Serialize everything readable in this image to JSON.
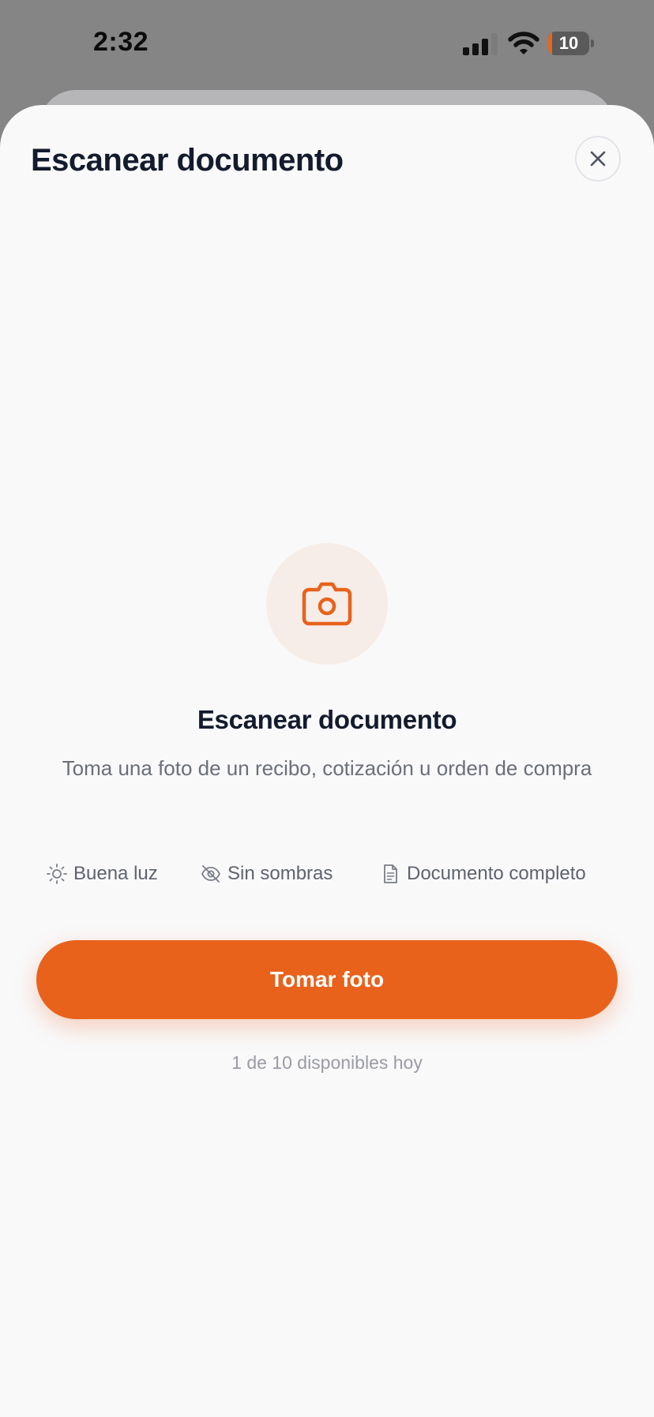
{
  "status_bar": {
    "time": "2:32",
    "battery_level": "10",
    "battery_fraction": 0.1,
    "battery_color": "#e8661d"
  },
  "header": {
    "title": "Escanear documento",
    "close_icon": "close-icon"
  },
  "content": {
    "icon": "camera-icon",
    "title": "Escanear documento",
    "description": "Toma una foto de un recibo, cotización u orden de compra",
    "tips": [
      {
        "icon": "sun-icon",
        "label": "Buena luz"
      },
      {
        "icon": "eye-off-icon",
        "label": "Sin sombras"
      },
      {
        "icon": "document-icon",
        "label": "Documento completo"
      }
    ],
    "primary_button": "Tomar foto",
    "usage": "1 de 10 disponibles hoy"
  },
  "colors": {
    "accent": "#e8621c",
    "accent_soft": "#f6ede8",
    "text_primary": "#141b2d",
    "text_secondary": "#6b6f78",
    "sheet_background": "#f9f9fa"
  }
}
